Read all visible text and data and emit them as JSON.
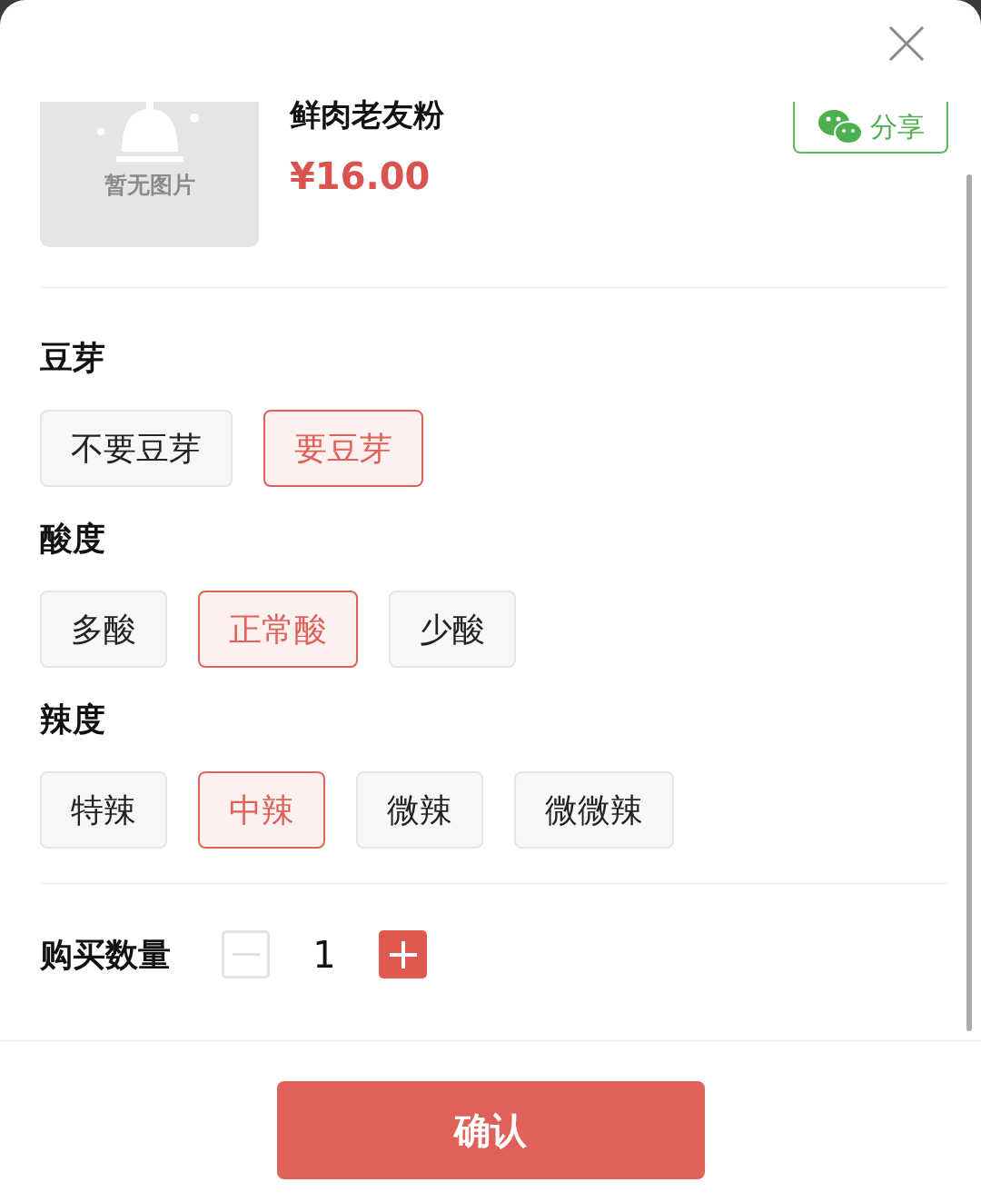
{
  "product": {
    "image_placeholder": "暂无图片",
    "title": "鲜肉老友粉",
    "price": "¥16.00",
    "share_label": "分享"
  },
  "option_groups": [
    {
      "title": "豆芽",
      "options": [
        {
          "label": "不要豆芽",
          "selected": false
        },
        {
          "label": "要豆芽",
          "selected": true
        }
      ]
    },
    {
      "title": "酸度",
      "options": [
        {
          "label": "多酸",
          "selected": false
        },
        {
          "label": "正常酸",
          "selected": true
        },
        {
          "label": "少酸",
          "selected": false
        }
      ]
    },
    {
      "title": "辣度",
      "options": [
        {
          "label": "特辣",
          "selected": false
        },
        {
          "label": "中辣",
          "selected": true
        },
        {
          "label": "微辣",
          "selected": false
        },
        {
          "label": "微微辣",
          "selected": false
        }
      ]
    }
  ],
  "quantity": {
    "label": "购买数量",
    "value": "1",
    "minus_disabled": true
  },
  "confirm_button": "确认"
}
